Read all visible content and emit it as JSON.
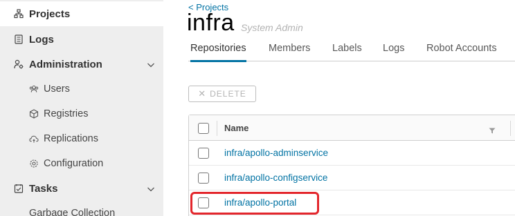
{
  "sidebar": {
    "items": [
      {
        "label": "Projects",
        "icon": "projects-icon"
      },
      {
        "label": "Logs",
        "icon": "logs-icon"
      },
      {
        "label": "Administration",
        "icon": "administration-icon"
      },
      {
        "label": "Users",
        "icon": "users-icon"
      },
      {
        "label": "Registries",
        "icon": "registries-icon"
      },
      {
        "label": "Replications",
        "icon": "replications-icon"
      },
      {
        "label": "Configuration",
        "icon": "configuration-icon"
      },
      {
        "label": "Tasks",
        "icon": "tasks-icon"
      },
      {
        "label": "Garbage Collection"
      }
    ]
  },
  "header": {
    "breadcrumb": "< Projects",
    "title": "infra",
    "role": "System Admin"
  },
  "tabs": [
    {
      "label": "Repositories"
    },
    {
      "label": "Members"
    },
    {
      "label": "Labels"
    },
    {
      "label": "Logs"
    },
    {
      "label": "Robot Accounts"
    }
  ],
  "toolbar": {
    "delete_label": "DELETE"
  },
  "grid": {
    "column_name": "Name",
    "rows": [
      {
        "name": "infra/apollo-adminservice"
      },
      {
        "name": "infra/apollo-configservice"
      },
      {
        "name": "infra/apollo-portal"
      }
    ]
  },
  "colors": {
    "accent": "#0072a3",
    "highlight": "#e3262c",
    "sidebar_bg": "#eeeeee"
  }
}
